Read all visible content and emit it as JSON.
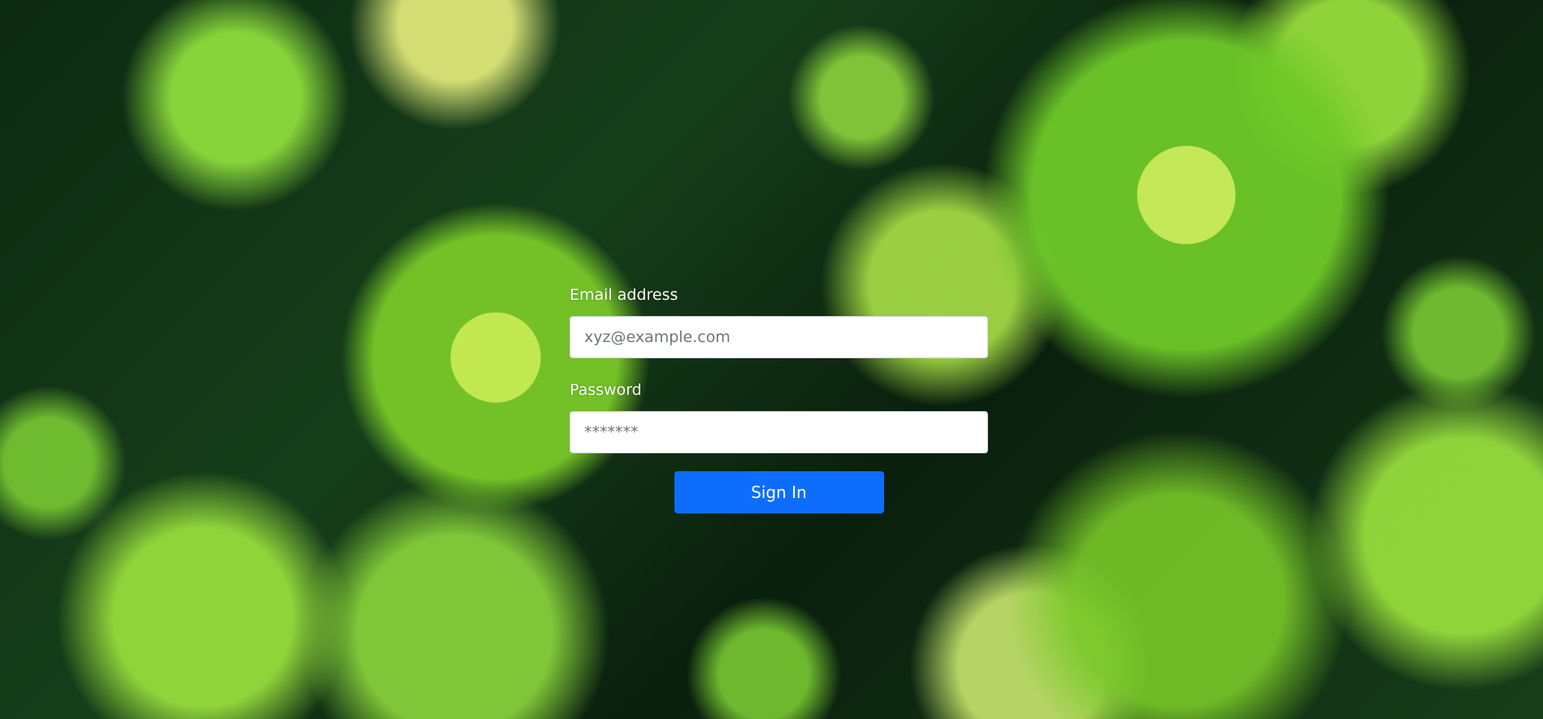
{
  "login": {
    "email_label": "Email address",
    "email_placeholder": "xyz@example.com",
    "password_label": "Password",
    "password_placeholder": "*******",
    "submit_label": "Sign In"
  },
  "colors": {
    "button_bg": "#0d6efd",
    "label_text": "#ffffff"
  }
}
